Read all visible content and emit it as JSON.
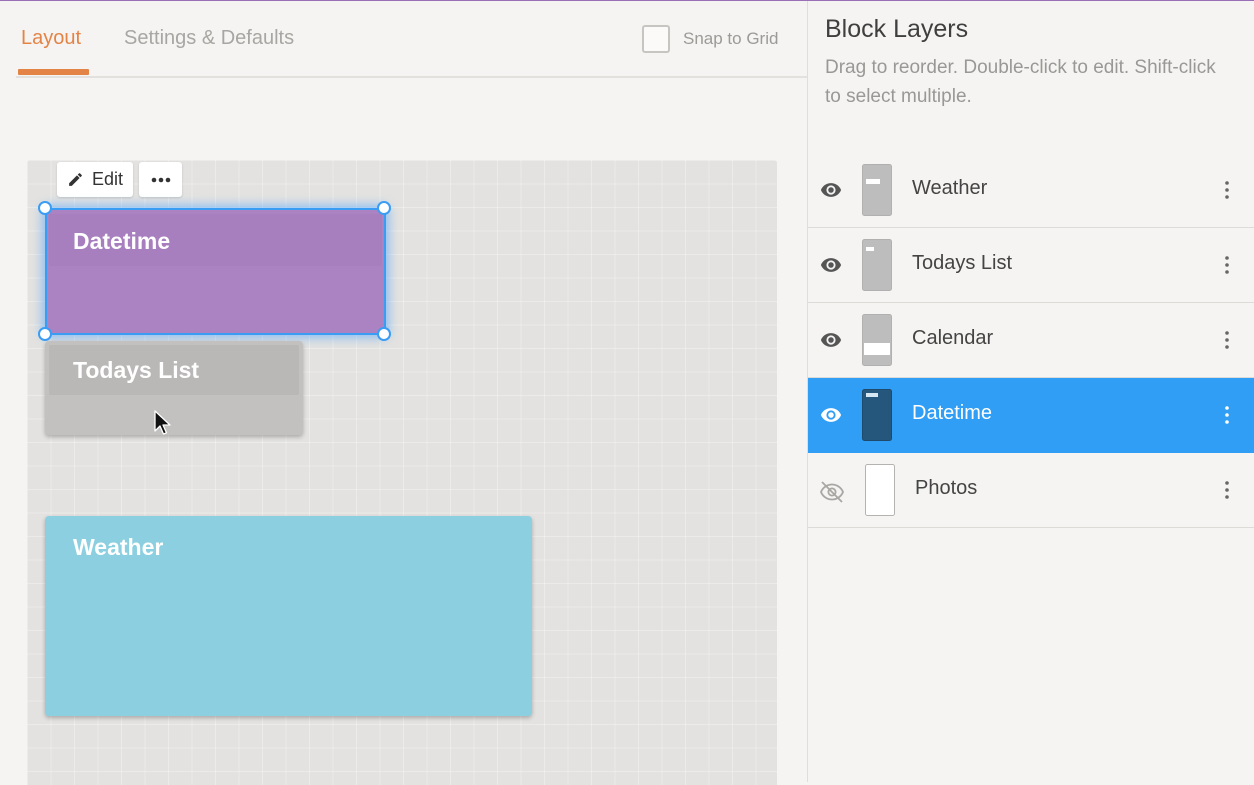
{
  "tabs": {
    "layout": "Layout",
    "settings": "Settings & Defaults"
  },
  "snap_to_grid": {
    "label": "Snap to Grid",
    "checked": false
  },
  "canvas": {
    "toolbar": {
      "edit_label": "Edit"
    },
    "blocks": {
      "datetime": "Datetime",
      "todays_list": "Todays List",
      "weather": "Weather"
    }
  },
  "panel": {
    "title": "Block Layers",
    "description": "Drag to reorder. Double-click to edit. Shift-click to select multiple.",
    "layers": [
      {
        "name": "Weather",
        "visible": true,
        "selected": false
      },
      {
        "name": "Todays List",
        "visible": true,
        "selected": false
      },
      {
        "name": "Calendar",
        "visible": true,
        "selected": false
      },
      {
        "name": "Datetime",
        "visible": true,
        "selected": true
      },
      {
        "name": "Photos",
        "visible": false,
        "selected": false
      }
    ]
  },
  "colors": {
    "accent": "#e38446",
    "selection": "#2f9ef4",
    "datetime_block": "#ab83c3",
    "weather_block": "#8bcfe0",
    "todays_block": "#c2c1bf"
  },
  "icons": [
    "pencil-icon",
    "more-horizontal-icon",
    "eye-icon",
    "eye-off-icon",
    "more-vertical-icon",
    "mouse-pointer-icon"
  ]
}
